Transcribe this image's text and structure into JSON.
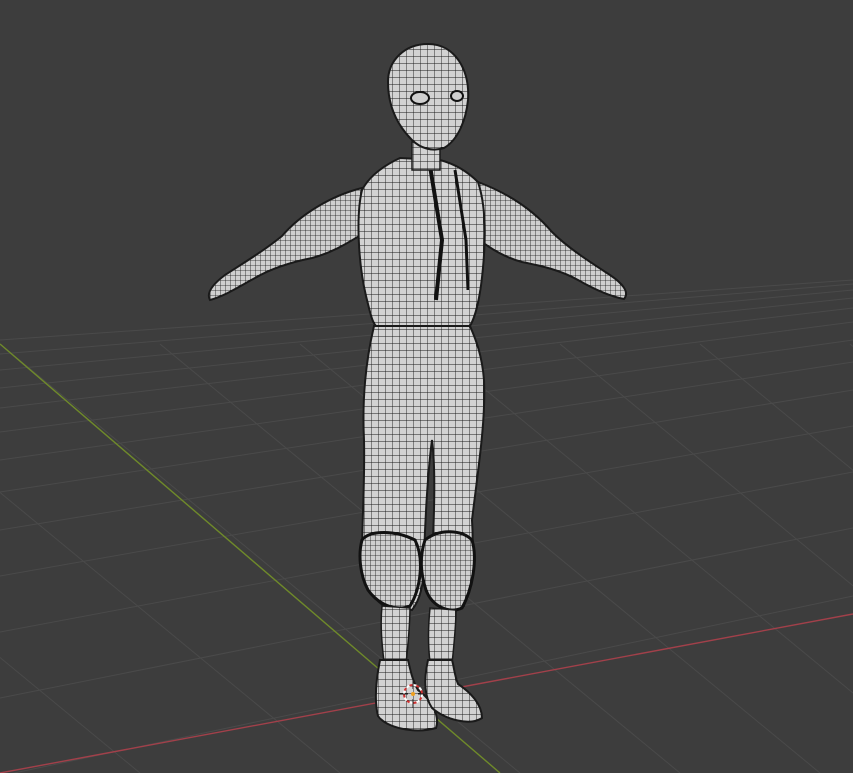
{
  "viewport": {
    "background": "#3d3d3d",
    "grid_color": "#4a4a4a",
    "x_axis_color": "#a2404a",
    "y_axis_color": "#6f8a2a",
    "mesh_fill": "#d2d2d2",
    "wire_color": "#1a1a1a",
    "cursor_icon": "3d-cursor-icon"
  }
}
